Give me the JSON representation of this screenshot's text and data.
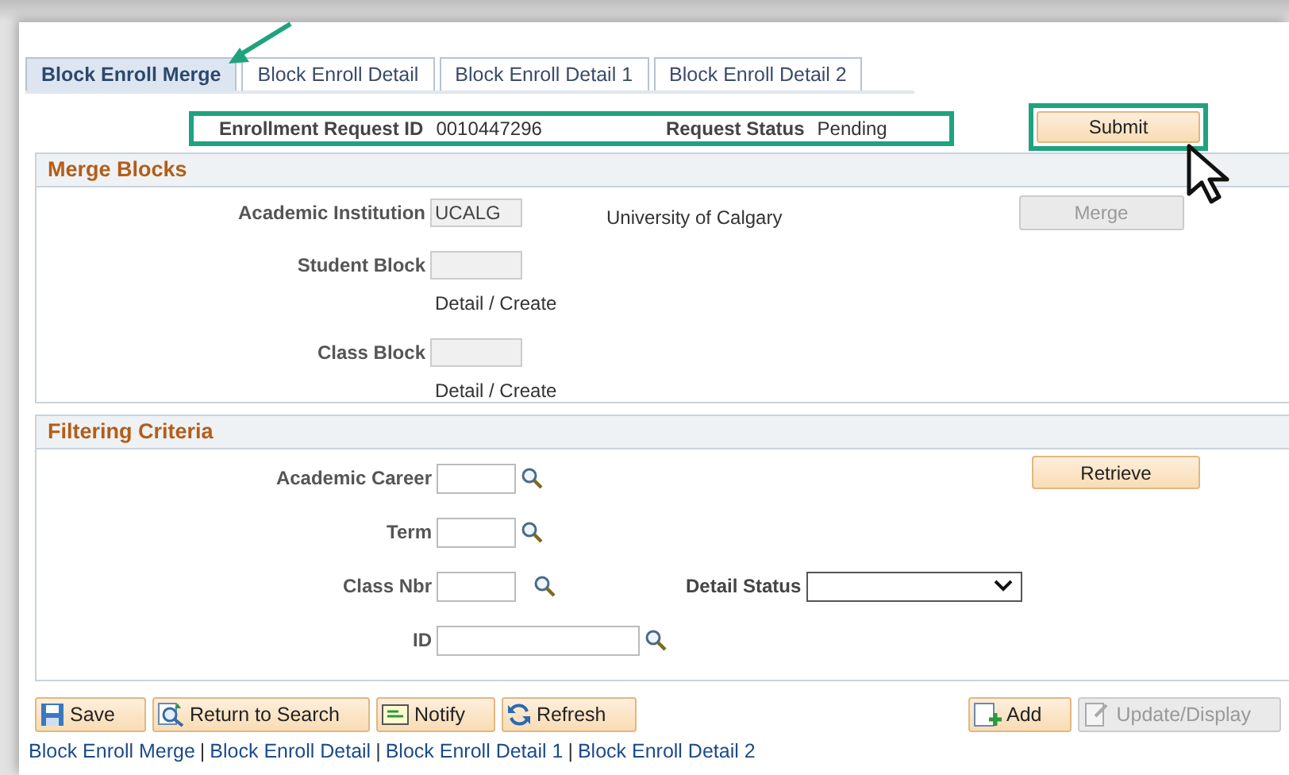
{
  "tabs": [
    {
      "label": "Block Enroll Merge",
      "selected": true
    },
    {
      "label": "Block Enroll Detail",
      "selected": false
    },
    {
      "label": "Block Enroll Detail 1",
      "selected": false
    },
    {
      "label": "Block Enroll Detail 2",
      "selected": false
    }
  ],
  "header": {
    "fields": [
      {
        "label": "Enrollment Request ID",
        "value": "0010447296"
      },
      {
        "label": "Request Status",
        "value": "Pending"
      }
    ],
    "submit": "Submit"
  },
  "merge_blocks": {
    "title": "Merge Blocks",
    "institution": {
      "label": "Academic Institution",
      "value": "UCALG",
      "description": "University of Calgary"
    },
    "merge_button": {
      "label": "Merge",
      "disabled": true
    },
    "blocks": [
      {
        "label": "Student Block",
        "link": "Detail / Create"
      },
      {
        "label": "Class Block",
        "link": "Detail / Create"
      }
    ]
  },
  "filtering": {
    "title": "Filtering Criteria",
    "retrieve": "Retrieve",
    "fields": [
      {
        "label": "Academic Career",
        "kind": "lookup"
      },
      {
        "label": "Term",
        "kind": "lookup"
      },
      {
        "label": "Class Nbr",
        "kind": "lookup",
        "select": {
          "label": "Detail Status"
        }
      },
      {
        "label": "ID",
        "kind": "wide_lookup"
      }
    ]
  },
  "toolbar": {
    "left": [
      {
        "label": "Save",
        "kind": "save"
      },
      {
        "label": "Return to Search",
        "kind": "search"
      },
      {
        "label": "Notify",
        "kind": "notify"
      },
      {
        "label": "Refresh",
        "kind": "refresh"
      }
    ],
    "right": [
      {
        "label": "Add",
        "kind": "add",
        "disabled": false
      },
      {
        "label": "Update/Display",
        "kind": "update",
        "disabled": true
      }
    ]
  },
  "links": {
    "separator": "|",
    "items": [
      "Block Enroll Merge",
      "Block Enroll Detail",
      "Block Enroll Detail 1",
      "Block Enroll Detail 2"
    ]
  }
}
